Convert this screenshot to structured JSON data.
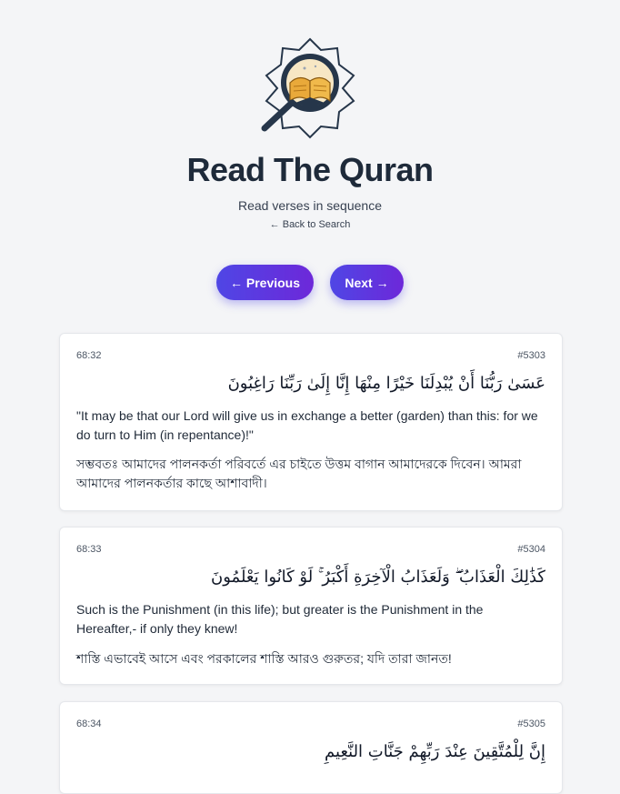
{
  "header": {
    "title": "Read The Quran",
    "subtitle": "Read verses in sequence",
    "back_link": "← Back to Search"
  },
  "nav": {
    "previous_label": "← Previous",
    "next_label": "Next →"
  },
  "colors": {
    "accent_start": "#4f46e5",
    "accent_end": "#6d28d9",
    "background": "#f4f5f7",
    "title": "#1e2a3a"
  },
  "verses": [
    {
      "ref": "68:32",
      "number": "#5303",
      "arabic": "عَسَىٰ رَبُّنَا أَنْ يُبْدِلَنَا خَيْرًا مِنْهَا إِنَّا إِلَىٰ رَبِّنَا رَاغِبُونَ",
      "english": "\"It may be that our Lord will give us in exchange a better (garden) than this: for we do turn to Him (in repentance)!\"",
      "bangla": "সম্ভবতঃ আমাদের পালনকর্তা পরিবর্তে এর চাইতে উত্তম বাগান আমাদেরকে দিবেন। আমরা আমাদের পালনকর্তার কাছে আশাবাদী।"
    },
    {
      "ref": "68:33",
      "number": "#5304",
      "arabic": "كَذَٰلِكَ الْعَذَابُ ۖ وَلَعَذَابُ الْآخِرَةِ أَكْبَرُ ۚ لَوْ كَانُوا يَعْلَمُونَ",
      "english": "Such is the Punishment (in this life); but greater is the Punishment in the Hereafter,- if only they knew!",
      "bangla": "শাস্তি এভাবেই আসে এবং পরকালের শাস্তি আরও গুরুতর; যদি তারা জানত!"
    },
    {
      "ref": "68:34",
      "number": "#5305",
      "arabic": "إِنَّ لِلْمُتَّقِينَ عِنْدَ رَبِّهِمْ جَنَّاتِ النَّعِيمِ",
      "english": "",
      "bangla": ""
    }
  ]
}
